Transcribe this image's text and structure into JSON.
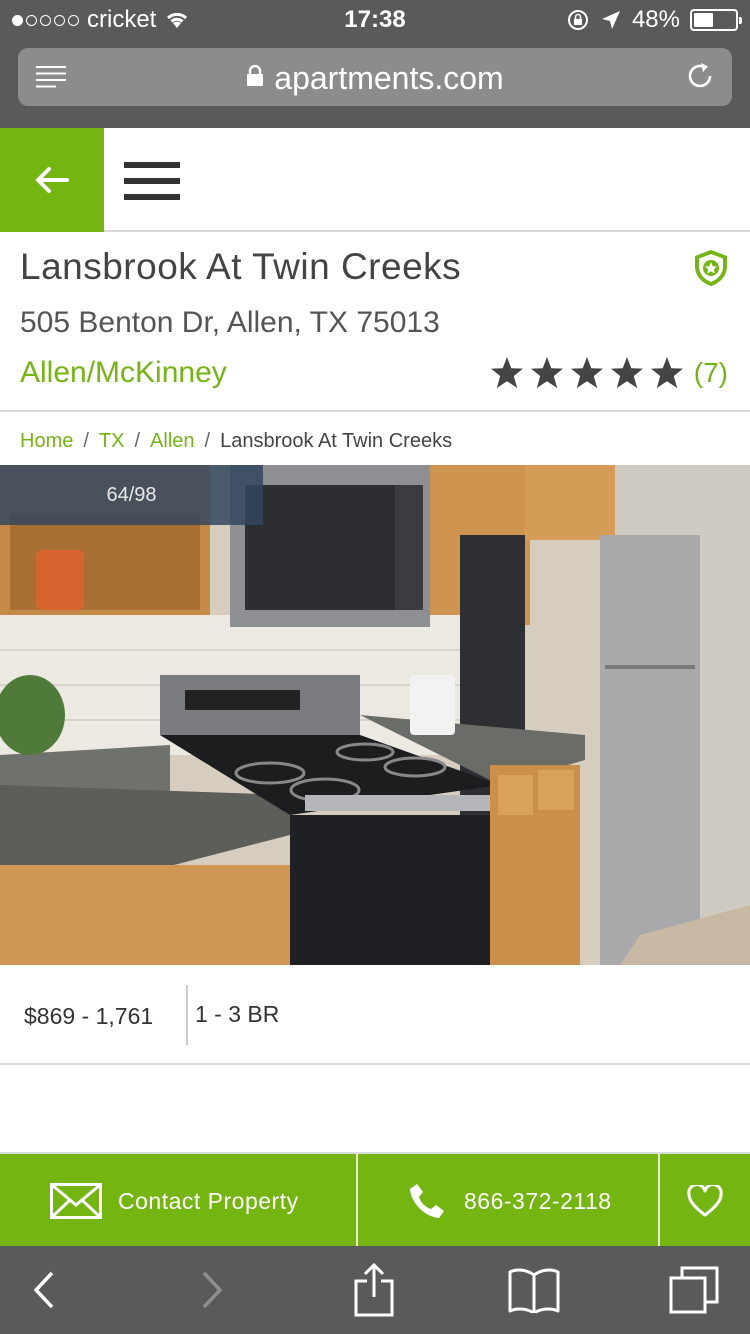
{
  "status_bar": {
    "carrier": "cricket",
    "time": "17:38",
    "battery": "48%",
    "battery_level": 0.48,
    "signal_bars_filled": 1,
    "signal_bars_total": 5
  },
  "address_bar": {
    "url": "apartments.com"
  },
  "property": {
    "name": "Lansbrook At Twin Creeks",
    "address": "505 Benton Dr, Allen, TX 75013",
    "area": "Allen/McKinney",
    "rating_stars": 5,
    "review_count": "(7)"
  },
  "breadcrumb": {
    "home": "Home",
    "state": "TX",
    "city": "Allen",
    "current": "Lansbrook At Twin Creeks",
    "separator": "/"
  },
  "photo": {
    "counter": "64/98",
    "subject": "kitchen with stove, microwave and refrigerator"
  },
  "pricing": {
    "rent": "$869 - 1,761",
    "beds": "1 - 3 BR"
  },
  "contact_bar": {
    "contact_label": "Contact Property",
    "phone": "866-372-2118"
  },
  "colors": {
    "brand_green": "#75b512",
    "chrome_gray": "#5a5a5a"
  },
  "icons": [
    "back-arrow-icon",
    "hamburger-icon",
    "shield-icon",
    "star-icon",
    "envelope-icon",
    "phone-icon",
    "heart-icon",
    "lock-icon",
    "reload-icon",
    "reader-icon",
    "share-icon",
    "bookmarks-icon",
    "tabs-icon"
  ]
}
